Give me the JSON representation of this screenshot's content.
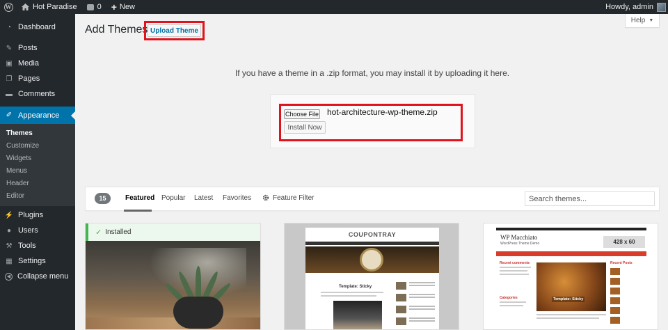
{
  "adminbar": {
    "site_name": "Hot Paradise",
    "comments_count": "0",
    "new_label": "New",
    "howdy": "Howdy, admin"
  },
  "sidebar": {
    "items": [
      {
        "label": "Dashboard",
        "icon": "dashboard-icon"
      },
      {
        "label": "Posts",
        "icon": "pin-icon"
      },
      {
        "label": "Media",
        "icon": "media-icon"
      },
      {
        "label": "Pages",
        "icon": "pages-icon"
      },
      {
        "label": "Comments",
        "icon": "comment-icon"
      },
      {
        "label": "Appearance",
        "icon": "paintbrush-icon"
      },
      {
        "label": "Plugins",
        "icon": "plug-icon"
      },
      {
        "label": "Users",
        "icon": "user-icon"
      },
      {
        "label": "Tools",
        "icon": "wrench-icon"
      },
      {
        "label": "Settings",
        "icon": "settings-icon"
      }
    ],
    "submenu": [
      "Themes",
      "Customize",
      "Widgets",
      "Menus",
      "Header",
      "Editor"
    ],
    "collapse_label": "Collapse menu"
  },
  "header": {
    "title": "Add Themes",
    "upload_label": "Upload Theme",
    "help_label": "Help"
  },
  "upload": {
    "help_text": "If you have a theme in a .zip format, you may install it by uploading it here.",
    "choose_label": "Choose File",
    "file_name": "hot-architecture-wp-theme.zip",
    "install_label": "Install Now"
  },
  "filter": {
    "count": "15",
    "tabs": [
      "Featured",
      "Popular",
      "Latest",
      "Favorites"
    ],
    "feature_filter": "Feature Filter",
    "search_placeholder": "Search themes..."
  },
  "themes": {
    "installed_label": "Installed",
    "coupontray_logo": "COUPONTRAY",
    "coupontray_sticky": "Template: Sticky",
    "macchiato_title": "WP Macchiato",
    "macchiato_subtitle": "WordPress Theme Demo",
    "macchiato_ad": "428 x 60",
    "macchiato_sticky": "Template: Sticky",
    "macchiato_recent": "Recent comments",
    "macchiato_categories": "Categories",
    "macchiato_recent_posts": "Recent Posts"
  },
  "colors": {
    "admin_dark": "#23282d",
    "accent": "#0073aa",
    "highlight_red": "#e0121b",
    "installed_green": "#46b450"
  }
}
